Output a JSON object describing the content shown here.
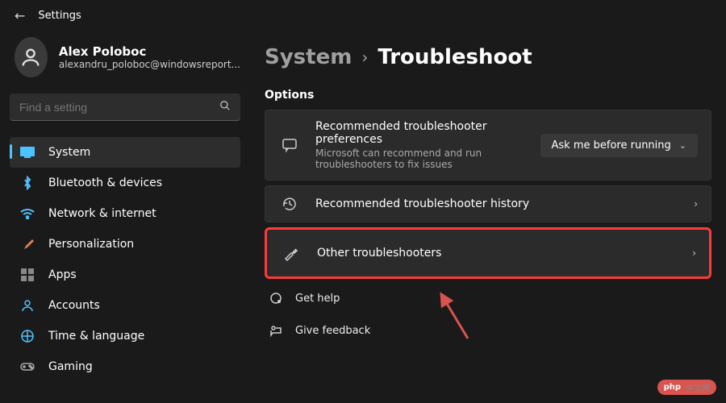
{
  "app": {
    "title": "Settings"
  },
  "profile": {
    "name": "Alex Poloboc",
    "email": "alexandru_poloboc@windowsreport..."
  },
  "search": {
    "placeholder": "Find a setting"
  },
  "nav": [
    {
      "label": "System",
      "active": true
    },
    {
      "label": "Bluetooth & devices"
    },
    {
      "label": "Network & internet"
    },
    {
      "label": "Personalization"
    },
    {
      "label": "Apps"
    },
    {
      "label": "Accounts"
    },
    {
      "label": "Time & language"
    },
    {
      "label": "Gaming"
    }
  ],
  "breadcrumb": {
    "parent": "System",
    "current": "Troubleshoot"
  },
  "main": {
    "section": "Options",
    "card_pref": {
      "title": "Recommended troubleshooter preferences",
      "sub": "Microsoft can recommend and run troubleshooters to fix issues",
      "dropdown": "Ask me before running"
    },
    "card_history": {
      "title": "Recommended troubleshooter history"
    },
    "card_other": {
      "title": "Other troubleshooters"
    },
    "help": {
      "get_help": "Get help",
      "feedback": "Give feedback"
    }
  },
  "watermark": {
    "php": "php",
    "cn": "中文网"
  }
}
